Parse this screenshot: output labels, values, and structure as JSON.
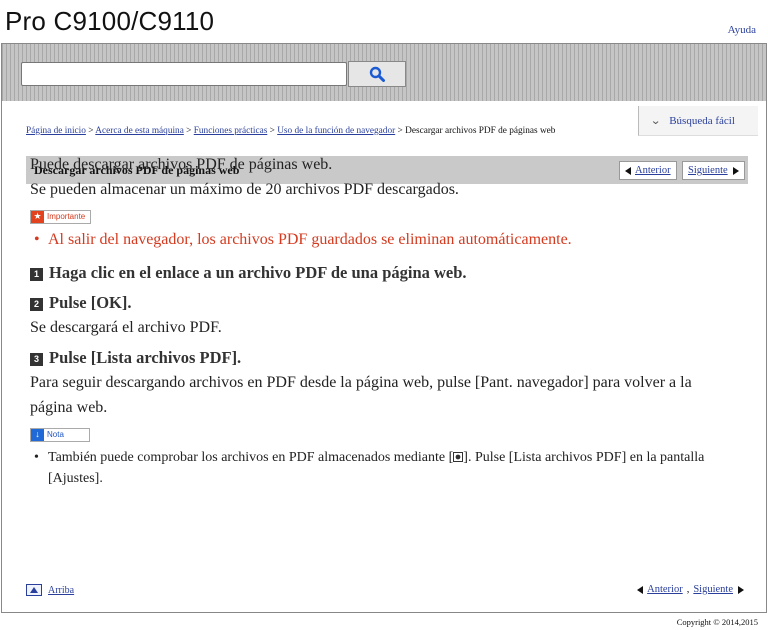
{
  "header": {
    "product_title": "Pro C9100/C9110",
    "help_label": "Ayuda"
  },
  "search": {
    "placeholder": "",
    "button_icon": "search-icon"
  },
  "quick_search": {
    "label": "Búsqueda fácil",
    "icon": "double-chevron-down-icon"
  },
  "breadcrumb": {
    "items": [
      "Página de inicio",
      "Acerca de esta máquina",
      "Funciones prácticas",
      "Uso de la función de navegador"
    ],
    "separator": ">",
    "current": "Descargar archivos PDF de páginas web"
  },
  "section": {
    "title": "Descargar archivos PDF de páginas web",
    "prev_label": "Anterior",
    "next_label": "Siguiente"
  },
  "content": {
    "intro": "Puede descargar archivos PDF de páginas web.",
    "intro2": "Se pueden almacenar un máximo de 20 archivos PDF descargados.",
    "important_label": "Importante",
    "important_text": "Al salir del navegador, los archivos PDF guardados se eliminan automáticamente.",
    "steps": [
      {
        "num": "1",
        "text": "Haga clic en el enlace a un archivo PDF de una página web."
      },
      {
        "num": "2",
        "text": "Pulse [OK]."
      },
      {
        "num": "3",
        "text": "Pulse [Lista archivos PDF]."
      }
    ],
    "step2_result": "Se descargará el archivo PDF.",
    "step3_result": "Para seguir descargando archivos en PDF desde la página web, pulse [Pant. navegador] para volver a la página web.",
    "note_label": "Nota",
    "note_text_before": "También puede comprobar los archivos en PDF almacenados mediante [",
    "note_text_after": "]. Pulse [Lista archivos PDF] en la pantalla [Ajustes]."
  },
  "footer": {
    "top_label": "Arriba",
    "prev_label": "Anterior",
    "separator": ",",
    "next_label": "Siguiente",
    "copyright": "Copyright © 2014,2015"
  },
  "colors": {
    "link": "#2a3f9b",
    "important": "#d43a1f",
    "note": "#1f6ad6",
    "heading_bar": "#c9c9c9"
  }
}
